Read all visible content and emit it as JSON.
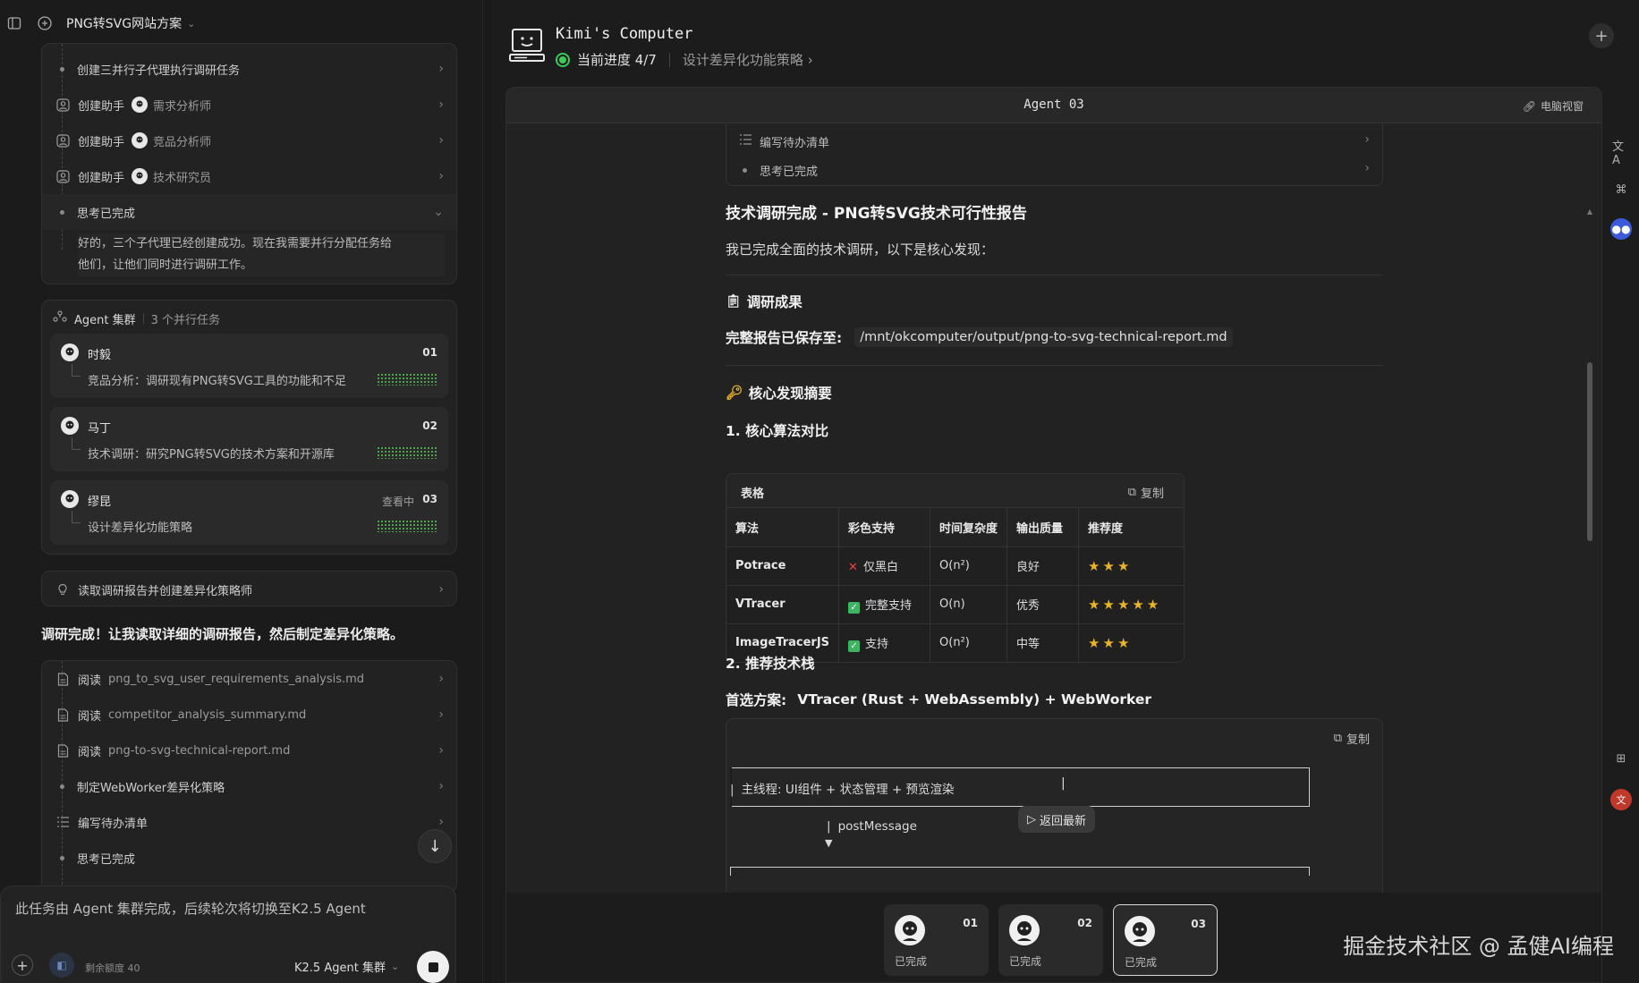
{
  "left": {
    "project_title": "PNG转SVG网站方案",
    "top_rows": [
      {
        "label": "创建三并行子代理执行调研任务"
      },
      {
        "label": "创建助手",
        "sub": "需求分析师"
      },
      {
        "label": "创建助手",
        "sub": "竞品分析师"
      },
      {
        "label": "创建助手",
        "sub": "技术研究员"
      },
      {
        "label": "思考已完成"
      }
    ],
    "thinking_text_1": "好的，三个子代理已经创建成功。现在我需要并行分配任务给",
    "thinking_text_2": "他们，让他们同时进行调研工作。",
    "swarm_title": "Agent 集群",
    "swarm_count": "3 个并行任务",
    "agents": [
      {
        "name": "时毅",
        "num": "01",
        "status": "",
        "task": "竞品分析：调研现有PNG转SVG工具的功能和不足"
      },
      {
        "name": "马丁",
        "num": "02",
        "status": "",
        "task": "技术调研：研究PNG转SVG的技术方案和开源库"
      },
      {
        "name": "缪昆",
        "num": "03",
        "status": "查看中",
        "task": "设计差异化功能策略"
      }
    ],
    "read_report_row": "读取调研报告并创建差异化策略师",
    "done_message": "调研完成！让我读取详细的调研报告，然后制定差异化策略。",
    "read_rows": [
      {
        "label": "阅读",
        "file": "png_to_svg_user_requirements_analysis.md"
      },
      {
        "label": "阅读",
        "file": "competitor_analysis_summary.md"
      },
      {
        "label": "阅读",
        "file": "png-to-svg-technical-report.md"
      },
      {
        "label": "制定WebWorker差异化策略",
        "file": ""
      },
      {
        "label": "编写待办清单",
        "file": ""
      },
      {
        "label": "思考已完成",
        "file": ""
      }
    ],
    "input_notice": "此任务由 Agent 集群完成，后续轮次将切换至K2.5 Agent",
    "quota": "剩余额度 40",
    "model": "K2.5 Agent 集群"
  },
  "right": {
    "computer_title": "Kimi's Computer",
    "progress": "当前进度 4/7",
    "current_step": "设计差异化功能策略",
    "viewer_title": "Agent 03",
    "viewer_link": "电脑视窗",
    "doc_rows": [
      "编写待办清单",
      "思考已完成"
    ],
    "report_title": "技术调研完成 - PNG转SVG技术可行性报告",
    "intro": "我已完成全面的技术调研，以下是核心发现：",
    "section_results": "调研成果",
    "saved_label": "完整报告已保存至:",
    "saved_path": "/mnt/okcomputer/output/png-to-svg-technical-report.md",
    "section_summary": "核心发现摘要",
    "sub1": "1. 核心算法对比",
    "table_label": "表格",
    "copy_label": "复制",
    "table_headers": [
      "算法",
      "彩色支持",
      "时间复杂度",
      "输出质量",
      "推荐度"
    ],
    "table_rows": [
      {
        "algo": "Potrace",
        "color_mark": "x",
        "color": "仅黑白",
        "complexity": "O(n²)",
        "quality": "良好",
        "stars": 3
      },
      {
        "algo": "VTracer",
        "color_mark": "check",
        "color": "完整支持",
        "complexity": "O(n)",
        "quality": "优秀",
        "stars": 5
      },
      {
        "algo": "ImageTracerJS",
        "color_mark": "check",
        "color": "支持",
        "complexity": "O(n²)",
        "quality": "中等",
        "stars": 3
      }
    ],
    "sub2": "2. 推荐技术栈",
    "preferred_label": "首选方案:",
    "preferred_value": "VTracer (Rust + WebAssembly) + WebWorker",
    "code_line1": "主线程: UI组件 + 状态管理 + 预览渲染",
    "code_line2": "postMessage",
    "back_latest": "返回最新",
    "tabs": [
      {
        "num": "01",
        "status": "已完成"
      },
      {
        "num": "02",
        "status": "已完成"
      },
      {
        "num": "03",
        "status": "已完成"
      }
    ]
  },
  "watermark": "掘金技术社区 @ 孟健AI编程"
}
